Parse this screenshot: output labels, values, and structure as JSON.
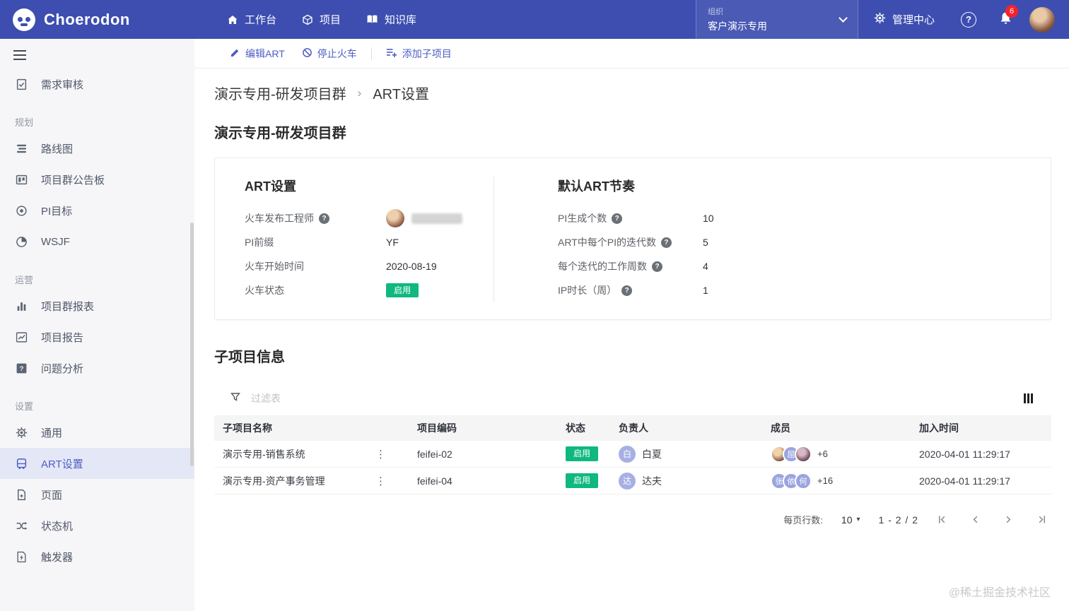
{
  "topbar": {
    "brand": "Choerodon",
    "nav": [
      {
        "label": "工作台"
      },
      {
        "label": "项目"
      },
      {
        "label": "知识库"
      }
    ],
    "org": {
      "caption": "组织",
      "value": "客户演示专用"
    },
    "admin_label": "管理中心",
    "notification_count": "6"
  },
  "sidebar": {
    "standalone": [
      {
        "label": "需求审核"
      }
    ],
    "groups": [
      {
        "title": "规划",
        "items": [
          {
            "label": "路线图"
          },
          {
            "label": "项目群公告板"
          },
          {
            "label": "PI目标"
          },
          {
            "label": "WSJF"
          }
        ]
      },
      {
        "title": "运营",
        "items": [
          {
            "label": "项目群报表"
          },
          {
            "label": "项目报告"
          },
          {
            "label": "问题分析"
          }
        ]
      },
      {
        "title": "设置",
        "items": [
          {
            "label": "通用"
          },
          {
            "label": "ART设置"
          },
          {
            "label": "页面"
          },
          {
            "label": "状态机"
          },
          {
            "label": "触发器"
          }
        ]
      }
    ]
  },
  "toolbar": {
    "edit": "编辑ART",
    "stop": "停止火车",
    "add": "添加子项目"
  },
  "breadcrumb": {
    "parent": "演示专用-研发项目群",
    "current": "ART设置"
  },
  "page": {
    "title": "演示专用-研发项目群"
  },
  "art_settings": {
    "title": "ART设置",
    "fields": [
      {
        "label": "火车发布工程师",
        "value": ""
      },
      {
        "label": "PI前缀",
        "value": "YF"
      },
      {
        "label": "火车开始时间",
        "value": "2020-08-19"
      },
      {
        "label": "火车状态",
        "value": "启用"
      }
    ]
  },
  "art_cadence": {
    "title": "默认ART节奏",
    "fields": [
      {
        "label": "PI生成个数",
        "value": "10"
      },
      {
        "label": "ART中每个PI的迭代数",
        "value": "5"
      },
      {
        "label": "每个迭代的工作周数",
        "value": "4"
      },
      {
        "label": "IP时长（周）",
        "value": "1"
      }
    ]
  },
  "subprojects": {
    "title": "子项目信息",
    "filter_placeholder": "过滤表",
    "columns": [
      "子项目名称",
      "项目编码",
      "状态",
      "负责人",
      "成员",
      "加入时间"
    ],
    "rows": [
      {
        "name": "演示专用-销售系统",
        "code": "feifei-02",
        "status": "启用",
        "owner": {
          "initial": "白",
          "name": "白夏"
        },
        "members": {
          "avatars": [
            {
              "label": ""
            },
            {
              "label": "屈"
            },
            {
              "label": ""
            }
          ],
          "extra": "+6"
        },
        "joined": "2020-04-01 11:29:17"
      },
      {
        "name": "演示专用-资产事务管理",
        "code": "feifei-04",
        "status": "启用",
        "owner": {
          "initial": "达",
          "name": "达夫"
        },
        "members": {
          "avatars": [
            {
              "label": "张"
            },
            {
              "label": "依"
            },
            {
              "label": "何"
            }
          ],
          "extra": "+16"
        },
        "joined": "2020-04-01 11:29:17"
      }
    ]
  },
  "pagination": {
    "per_page_label": "每页行数:",
    "page_size": "10",
    "range": "1 - 2 / 2"
  },
  "watermark": "@稀土掘金技术社区",
  "icons": {
    "help_glyph": "?",
    "breadcrumb_sep": "›",
    "dropdown_glyph": "▾",
    "ellipsis_glyph": "⋮"
  },
  "colors": {
    "topbar": "#3D4EB0",
    "accent": "#4E5CC4",
    "success": "#0FB87F",
    "badge_red": "#F5222D"
  }
}
